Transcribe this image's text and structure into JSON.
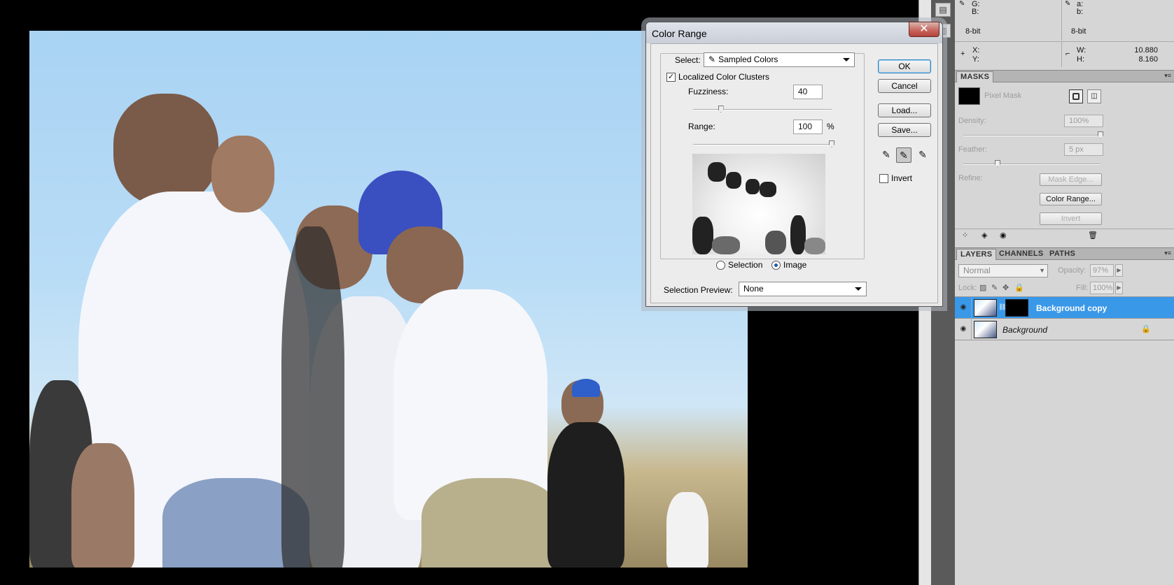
{
  "info_panel": {
    "g_label": "G:",
    "b_label": "B:",
    "a_label": "a:",
    "b2_label": "b:",
    "bitdepth_left": "8-bit",
    "bitdepth_right": "8-bit",
    "x_label": "X:",
    "y_label": "Y:",
    "w_label": "W:",
    "h_label": "H:",
    "w_value": "10.880",
    "h_value": "8.160"
  },
  "masks_panel": {
    "tab": "MASKS",
    "pixel_mask_label": "Pixel Mask",
    "density_label": "Density:",
    "density_value": "100%",
    "density_level": 1.0,
    "feather_label": "Feather:",
    "feather_value": "5 px",
    "feather_level": 0.25,
    "refine_label": "Refine:",
    "mask_edge_button": "Mask Edge...",
    "color_range_button": "Color Range...",
    "invert_button": "Invert"
  },
  "layers_panel": {
    "tabs": [
      "LAYERS",
      "CHANNELS",
      "PATHS"
    ],
    "blend_mode": "Normal",
    "opacity_label": "Opacity:",
    "opacity_value": "97%",
    "lock_label": "Lock:",
    "fill_label": "Fill:",
    "fill_value": "100%",
    "layers": [
      {
        "name": "Background copy",
        "selected": true
      },
      {
        "name": "Background",
        "selected": false
      }
    ]
  },
  "color_range_dialog": {
    "title": "Color Range",
    "close_glyph": "✕",
    "select_label": "Select:",
    "select_value": "Sampled Colors",
    "localized_label": "Localized Color Clusters",
    "localized_checked": true,
    "fuzziness_label": "Fuzziness:",
    "fuzziness_value": "40",
    "fuzziness_level": 0.2,
    "range_label": "Range:",
    "range_value": "100",
    "range_unit": "%",
    "range_level": 1.0,
    "selection_radio_label": "Selection",
    "image_radio_label": "Image",
    "selected_radio": "Image",
    "selection_preview_label": "Selection Preview:",
    "selection_preview_value": "None",
    "ok_button": "OK",
    "cancel_button": "Cancel",
    "load_button": "Load...",
    "save_button": "Save...",
    "invert_label": "Invert",
    "invert_checked": false
  },
  "colors": {
    "selected_layer": "#3a98e8",
    "panel_bg": "#d6d6d6",
    "canvas_bg": "#000000"
  }
}
